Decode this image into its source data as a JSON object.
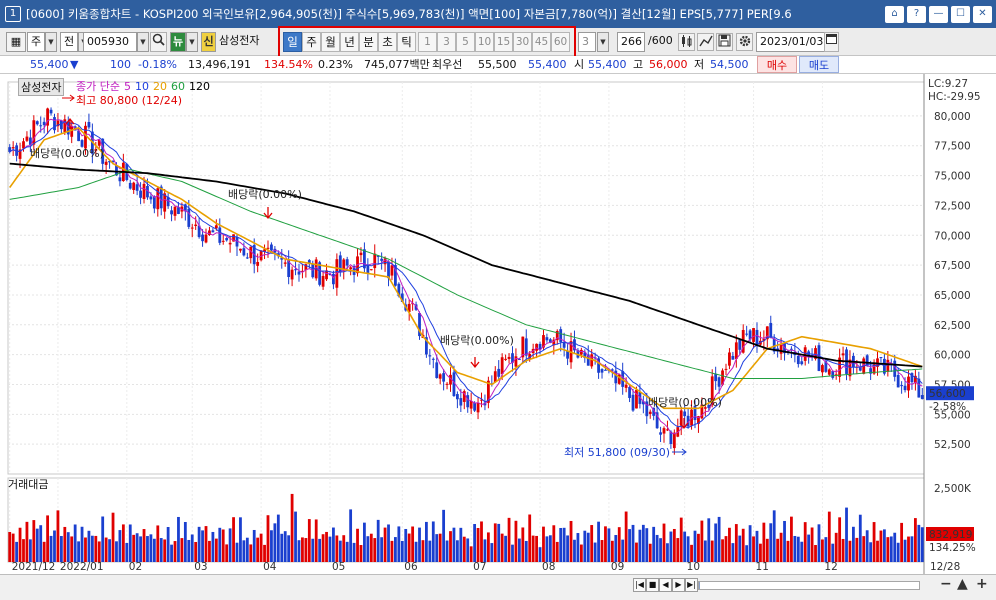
{
  "title_bar": {
    "app_number": "1",
    "title": "[0600] 키움종합차트 - KOSPI200 외국인보유[2,964,905(천)] 주식수[5,969,783(천)] 액면[100] 자본금[7,780(억)] 결산[12월] EPS[5,777] PER[9.6",
    "buttons": [
      "⌂",
      "?",
      "—",
      "☐",
      "✕"
    ]
  },
  "toolbar": {
    "chart_icon": "▦",
    "period_type": "주",
    "whole": "전",
    "code": "005930",
    "search_icon": "magnifier",
    "news_label": "뉴",
    "new_tag": "신",
    "stock_name": "삼성전자",
    "period_buttons": [
      "일",
      "주",
      "월",
      "년",
      "분",
      "초",
      "틱"
    ],
    "selected_period": "일",
    "interval_buttons": [
      "1",
      "3",
      "5",
      "10",
      "15",
      "30",
      "45",
      "60"
    ],
    "interval_value": "3",
    "count": "266",
    "count_total": "/600",
    "date": "2023/01/03"
  },
  "quote": {
    "price": "55,400",
    "direction": "▼",
    "change": "100",
    "change_pct": "-0.18%",
    "volume": "13,496,191",
    "vol_ratio": "134.54%",
    "turnover": "0.23%",
    "amount": "745,077백만",
    "best_ask_label": "최우선",
    "best_ask": "55,500",
    "best_bid": "55,400",
    "open_label": "시",
    "open": "55,400",
    "high_label": "고",
    "high": "56,000",
    "low_label": "저",
    "low": "54,500",
    "buy_label": "매수",
    "sell_label": "매도"
  },
  "chart": {
    "stock_tag": "삼성전자",
    "legend": {
      "title": "종가 단순",
      "periods": [
        "5",
        "10",
        "20",
        "60",
        "120"
      ],
      "colors": [
        "#c020c0",
        "#2040e0",
        "#e8a000",
        "#20a040",
        "#000000"
      ]
    },
    "lc": "LC:9.27",
    "hc": "HC:-29.95",
    "current_price_label": "56,600",
    "current_change_label": "-2.58%",
    "max_label": "최고 80,800 (12/24)",
    "min_label": "최저 51,800 (09/30)",
    "dividend_labels": [
      "배당락(0.00%)",
      "배당락(0.00%)",
      "배당락(0.00%)",
      "배당락(0.00%)"
    ],
    "volume_title": "거래대금",
    "volume_axis_label": "2,500K",
    "volume_current": "832,919",
    "volume_change": "134.25%",
    "end_date": "12/28"
  },
  "chart_data": {
    "type": "candlestick",
    "price_axis": {
      "ylim": [
        50000,
        82000
      ],
      "ticks": [
        "80,000",
        "77,500",
        "75,000",
        "72,500",
        "70,000",
        "67,500",
        "65,000",
        "62,500",
        "60,000",
        "57,500",
        "55,000",
        "52,500"
      ]
    },
    "x_ticks": [
      "2021/12",
      "2022/01",
      "02",
      "03",
      "04",
      "05",
      "06",
      "07",
      "08",
      "09",
      "10",
      "11",
      "12"
    ],
    "close_path": [
      [
        0,
        77000
      ],
      [
        6,
        78500
      ],
      [
        11,
        80000
      ],
      [
        17,
        79200
      ],
      [
        23,
        78000
      ],
      [
        29,
        76000
      ],
      [
        35,
        74500
      ],
      [
        40,
        73500
      ],
      [
        46,
        72500
      ],
      [
        52,
        71500
      ],
      [
        58,
        70000
      ],
      [
        64,
        69500
      ],
      [
        70,
        68500
      ],
      [
        76,
        67800
      ],
      [
        82,
        67500
      ],
      [
        88,
        67000
      ],
      [
        94,
        66800
      ],
      [
        100,
        67500
      ],
      [
        106,
        68000
      ],
      [
        112,
        66500
      ],
      [
        118,
        63000
      ],
      [
        124,
        59000
      ],
      [
        130,
        57000
      ],
      [
        136,
        56000
      ],
      [
        142,
        58500
      ],
      [
        148,
        60500
      ],
      [
        154,
        61500
      ],
      [
        160,
        61000
      ],
      [
        166,
        59500
      ],
      [
        172,
        58500
      ],
      [
        178,
        57000
      ],
      [
        184,
        55500
      ],
      [
        190,
        53000
      ],
      [
        196,
        54500
      ],
      [
        202,
        56000
      ],
      [
        208,
        59500
      ],
      [
        214,
        61500
      ],
      [
        220,
        61500
      ],
      [
        226,
        60500
      ],
      [
        232,
        60000
      ],
      [
        238,
        59000
      ],
      [
        244,
        59500
      ],
      [
        250,
        59000
      ],
      [
        256,
        58500
      ],
      [
        262,
        57500
      ],
      [
        265,
        56600
      ]
    ],
    "ma120": [
      [
        0,
        76000
      ],
      [
        20,
        75500
      ],
      [
        40,
        75200
      ],
      [
        60,
        74500
      ],
      [
        80,
        73500
      ],
      [
        100,
        72000
      ],
      [
        120,
        70000
      ],
      [
        140,
        67500
      ],
      [
        160,
        66000
      ],
      [
        180,
        64500
      ],
      [
        200,
        62500
      ],
      [
        220,
        60500
      ],
      [
        240,
        59500
      ],
      [
        265,
        59000
      ]
    ],
    "ma60": [
      [
        0,
        73000
      ],
      [
        20,
        74000
      ],
      [
        35,
        75500
      ],
      [
        50,
        74500
      ],
      [
        70,
        72000
      ],
      [
        90,
        70000
      ],
      [
        110,
        68000
      ],
      [
        130,
        65000
      ],
      [
        150,
        62500
      ],
      [
        170,
        61000
      ],
      [
        190,
        59500
      ],
      [
        210,
        58000
      ],
      [
        230,
        58000
      ],
      [
        250,
        58500
      ],
      [
        265,
        58800
      ]
    ],
    "ma20": [
      [
        0,
        74000
      ],
      [
        10,
        78000
      ],
      [
        20,
        79000
      ],
      [
        30,
        76000
      ],
      [
        40,
        74500
      ],
      [
        50,
        73000
      ],
      [
        60,
        71000
      ],
      [
        70,
        69500
      ],
      [
        80,
        68000
      ],
      [
        90,
        67500
      ],
      [
        100,
        67000
      ],
      [
        110,
        66500
      ],
      [
        120,
        61500
      ],
      [
        130,
        58500
      ],
      [
        140,
        57500
      ],
      [
        150,
        59500
      ],
      [
        160,
        60500
      ],
      [
        170,
        59500
      ],
      [
        180,
        57500
      ],
      [
        190,
        55500
      ],
      [
        200,
        55500
      ],
      [
        210,
        57000
      ],
      [
        220,
        60500
      ],
      [
        230,
        61500
      ],
      [
        240,
        61000
      ],
      [
        250,
        60500
      ],
      [
        260,
        59500
      ],
      [
        265,
        59000
      ]
    ],
    "volume_max": 2500000,
    "volume_cycle": [
      920000,
      1180000,
      780000,
      1420000,
      860000,
      1050000,
      690000,
      1300000,
      970000,
      1120000,
      640000,
      1250000,
      840000,
      1010000,
      1380000,
      760000
    ]
  }
}
